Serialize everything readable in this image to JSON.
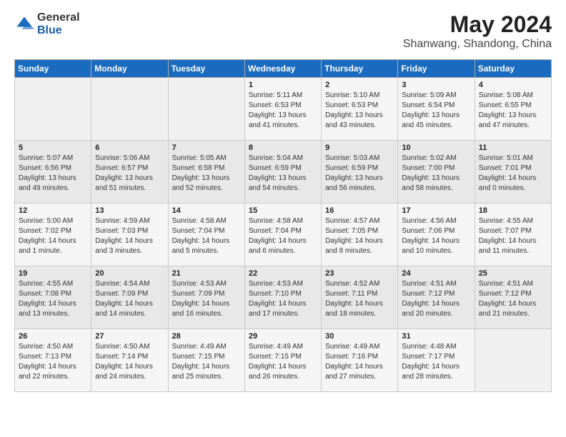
{
  "header": {
    "logo_general": "General",
    "logo_blue": "Blue",
    "month_year": "May 2024",
    "location": "Shanwang, Shandong, China"
  },
  "days_of_week": [
    "Sunday",
    "Monday",
    "Tuesday",
    "Wednesday",
    "Thursday",
    "Friday",
    "Saturday"
  ],
  "weeks": [
    [
      {
        "day": "",
        "content": ""
      },
      {
        "day": "",
        "content": ""
      },
      {
        "day": "",
        "content": ""
      },
      {
        "day": "1",
        "content": "Sunrise: 5:11 AM\nSunset: 6:53 PM\nDaylight: 13 hours\nand 41 minutes."
      },
      {
        "day": "2",
        "content": "Sunrise: 5:10 AM\nSunset: 6:53 PM\nDaylight: 13 hours\nand 43 minutes."
      },
      {
        "day": "3",
        "content": "Sunrise: 5:09 AM\nSunset: 6:54 PM\nDaylight: 13 hours\nand 45 minutes."
      },
      {
        "day": "4",
        "content": "Sunrise: 5:08 AM\nSunset: 6:55 PM\nDaylight: 13 hours\nand 47 minutes."
      }
    ],
    [
      {
        "day": "5",
        "content": "Sunrise: 5:07 AM\nSunset: 6:56 PM\nDaylight: 13 hours\nand 49 minutes."
      },
      {
        "day": "6",
        "content": "Sunrise: 5:06 AM\nSunset: 6:57 PM\nDaylight: 13 hours\nand 51 minutes."
      },
      {
        "day": "7",
        "content": "Sunrise: 5:05 AM\nSunset: 6:58 PM\nDaylight: 13 hours\nand 52 minutes."
      },
      {
        "day": "8",
        "content": "Sunrise: 5:04 AM\nSunset: 6:59 PM\nDaylight: 13 hours\nand 54 minutes."
      },
      {
        "day": "9",
        "content": "Sunrise: 5:03 AM\nSunset: 6:59 PM\nDaylight: 13 hours\nand 56 minutes."
      },
      {
        "day": "10",
        "content": "Sunrise: 5:02 AM\nSunset: 7:00 PM\nDaylight: 13 hours\nand 58 minutes."
      },
      {
        "day": "11",
        "content": "Sunrise: 5:01 AM\nSunset: 7:01 PM\nDaylight: 14 hours\nand 0 minutes."
      }
    ],
    [
      {
        "day": "12",
        "content": "Sunrise: 5:00 AM\nSunset: 7:02 PM\nDaylight: 14 hours\nand 1 minute."
      },
      {
        "day": "13",
        "content": "Sunrise: 4:59 AM\nSunset: 7:03 PM\nDaylight: 14 hours\nand 3 minutes."
      },
      {
        "day": "14",
        "content": "Sunrise: 4:58 AM\nSunset: 7:04 PM\nDaylight: 14 hours\nand 5 minutes."
      },
      {
        "day": "15",
        "content": "Sunrise: 4:58 AM\nSunset: 7:04 PM\nDaylight: 14 hours\nand 6 minutes."
      },
      {
        "day": "16",
        "content": "Sunrise: 4:57 AM\nSunset: 7:05 PM\nDaylight: 14 hours\nand 8 minutes."
      },
      {
        "day": "17",
        "content": "Sunrise: 4:56 AM\nSunset: 7:06 PM\nDaylight: 14 hours\nand 10 minutes."
      },
      {
        "day": "18",
        "content": "Sunrise: 4:55 AM\nSunset: 7:07 PM\nDaylight: 14 hours\nand 11 minutes."
      }
    ],
    [
      {
        "day": "19",
        "content": "Sunrise: 4:55 AM\nSunset: 7:08 PM\nDaylight: 14 hours\nand 13 minutes."
      },
      {
        "day": "20",
        "content": "Sunrise: 4:54 AM\nSunset: 7:09 PM\nDaylight: 14 hours\nand 14 minutes."
      },
      {
        "day": "21",
        "content": "Sunrise: 4:53 AM\nSunset: 7:09 PM\nDaylight: 14 hours\nand 16 minutes."
      },
      {
        "day": "22",
        "content": "Sunrise: 4:53 AM\nSunset: 7:10 PM\nDaylight: 14 hours\nand 17 minutes."
      },
      {
        "day": "23",
        "content": "Sunrise: 4:52 AM\nSunset: 7:11 PM\nDaylight: 14 hours\nand 18 minutes."
      },
      {
        "day": "24",
        "content": "Sunrise: 4:51 AM\nSunset: 7:12 PM\nDaylight: 14 hours\nand 20 minutes."
      },
      {
        "day": "25",
        "content": "Sunrise: 4:51 AM\nSunset: 7:12 PM\nDaylight: 14 hours\nand 21 minutes."
      }
    ],
    [
      {
        "day": "26",
        "content": "Sunrise: 4:50 AM\nSunset: 7:13 PM\nDaylight: 14 hours\nand 22 minutes."
      },
      {
        "day": "27",
        "content": "Sunrise: 4:50 AM\nSunset: 7:14 PM\nDaylight: 14 hours\nand 24 minutes."
      },
      {
        "day": "28",
        "content": "Sunrise: 4:49 AM\nSunset: 7:15 PM\nDaylight: 14 hours\nand 25 minutes."
      },
      {
        "day": "29",
        "content": "Sunrise: 4:49 AM\nSunset: 7:15 PM\nDaylight: 14 hours\nand 26 minutes."
      },
      {
        "day": "30",
        "content": "Sunrise: 4:49 AM\nSunset: 7:16 PM\nDaylight: 14 hours\nand 27 minutes."
      },
      {
        "day": "31",
        "content": "Sunrise: 4:48 AM\nSunset: 7:17 PM\nDaylight: 14 hours\nand 28 minutes."
      },
      {
        "day": "",
        "content": ""
      }
    ]
  ]
}
